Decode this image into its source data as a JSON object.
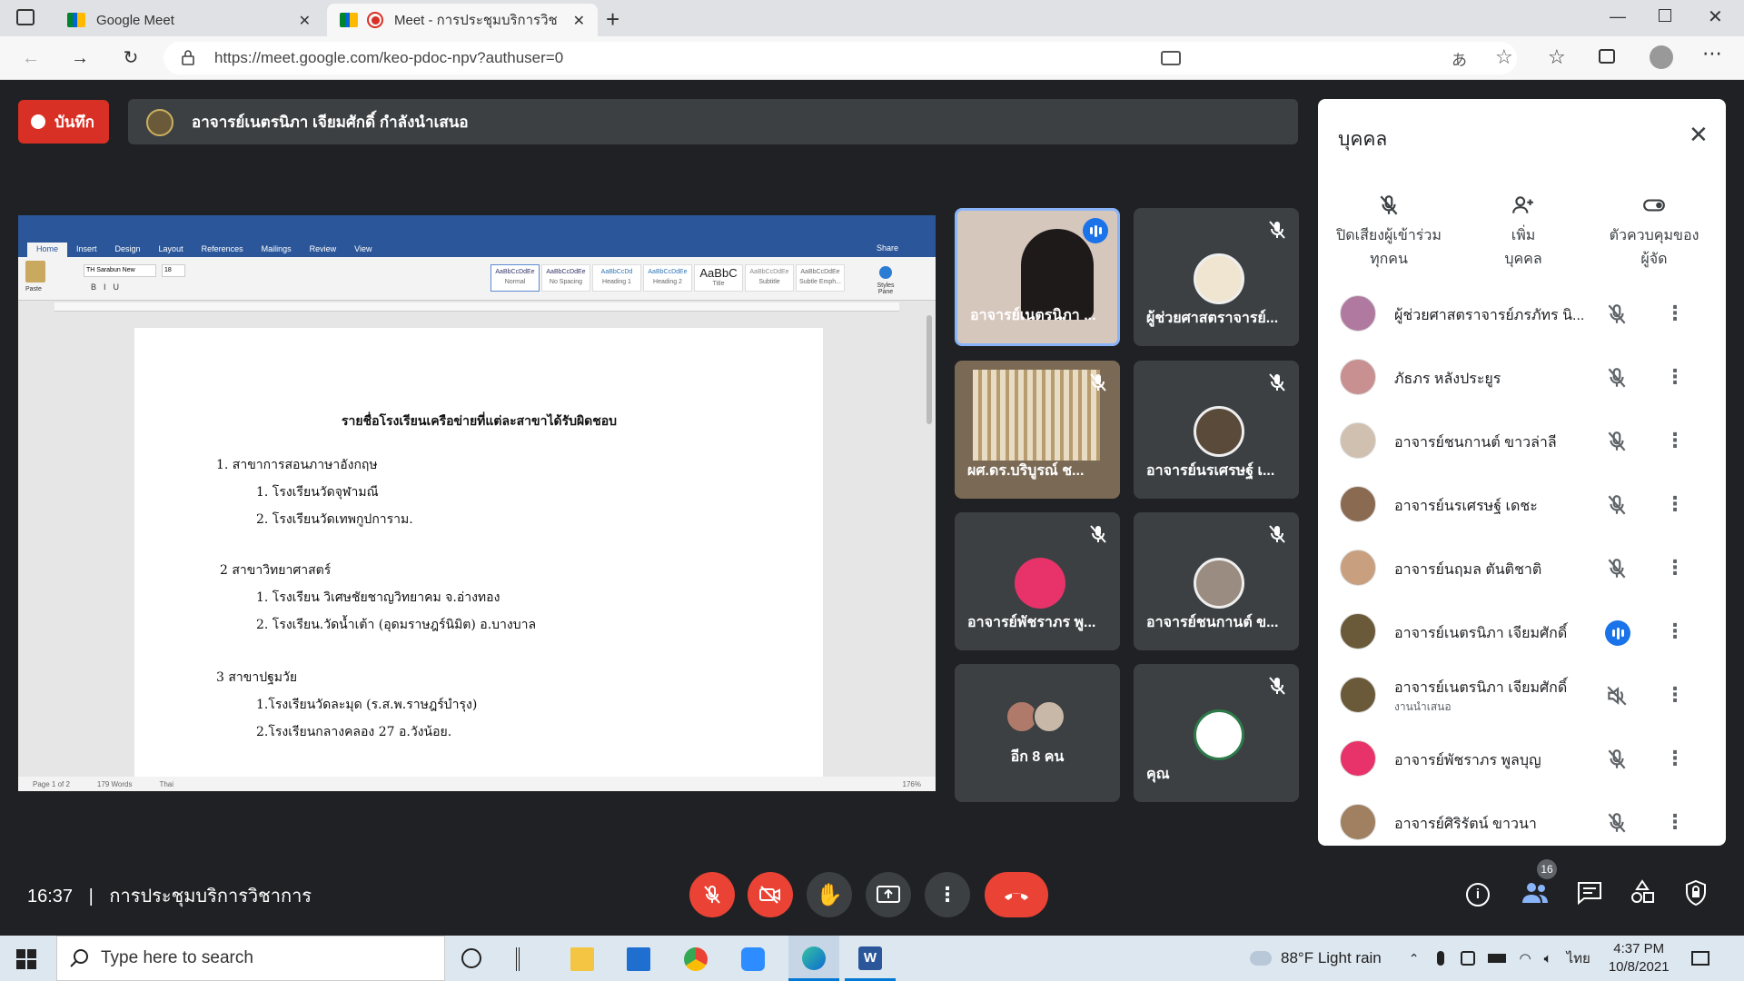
{
  "browser": {
    "tabs": [
      {
        "title": "Google Meet",
        "icon": "meet-icon"
      },
      {
        "title": "Meet - การประชุมบริการวิชาการ",
        "icon": "meet-icon",
        "recording": true
      }
    ],
    "url": "https://meet.google.com/keo-pdoc-npv?authuser=0",
    "window_controls": [
      "minimize",
      "maximize",
      "close"
    ]
  },
  "meet": {
    "record_label": "บันทึก",
    "presenting_text": "อาจารย์เนตรนิภา เจียมศักดิ์ กำลังนำเสนอ",
    "meeting_time": "16:37",
    "meeting_separator": "|",
    "meeting_name": "การประชุมบริการวิชาการ",
    "participant_count": "16"
  },
  "document": {
    "ribbon_tabs": [
      "Home",
      "Insert",
      "Design",
      "Layout",
      "References",
      "Mailings",
      "Review",
      "View"
    ],
    "share_label": "Share",
    "font_name": "TH Sarabun New",
    "font_size": "18",
    "styles": [
      "AaBbCcDdEe",
      "AaBbCcDdEe",
      "AaBbCcDd",
      "AaBbCcDdEe",
      "AaBbC",
      "AaBbCcDdEe",
      "AaBbCcDdEe"
    ],
    "style_names": [
      "Normal",
      "No Spacing",
      "Heading 1",
      "Heading 2",
      "Title",
      "Subtitle",
      "Subtle Emph..."
    ],
    "paste_label": "Paste",
    "styles_pane_label": "Styles Pane",
    "title": "รายชื่อโรงเรียนเครือข่ายที่แต่ละสาขาได้รับผิดชอบ",
    "lines": [
      "1. สาขาการสอนภาษาอังกฤษ",
      "1. โรงเรียนวัดจุฬามณี",
      "2. โรงเรียนวัดเทพกูปการาม.",
      "2 สาขาวิทยาศาสตร์",
      "1. โรงเรียน วิเศษชัยชาญวิทยาคม จ.อ่างทอง",
      "2. โรงเรียน.วัดน้ำเต้า (อุดมราษฎร์นิมิต) อ.บางบาล",
      "3 สาขาปฐมวัย",
      "1.โรงเรียนวัดละมุด (ร.ส.พ.ราษฎร์บำรุง)",
      "2.โรงเรียนกลางคลอง 27 อ.วังน้อย."
    ],
    "status": [
      "Page 1 of 2",
      "179 Words",
      "Thai"
    ],
    "zoom": "176%"
  },
  "tiles": [
    {
      "name": "อาจารย์เนตรนิภา ...",
      "state": "speaking"
    },
    {
      "name": "ผู้ช่วยศาสตราจารย์...",
      "state": "muted"
    },
    {
      "name": "ผศ.ดร.บริบูรณ์ ช...",
      "state": "muted"
    },
    {
      "name": "อาจารย์นรเศรษฐ์ เ...",
      "state": "muted"
    },
    {
      "name": "อาจารย์พัชราภร พู...",
      "state": "muted"
    },
    {
      "name": "อาจารย์ชนกานต์ ข...",
      "state": "muted"
    },
    {
      "name": "อีก 8 คน",
      "state": "more"
    },
    {
      "name": "คุณ",
      "state": "muted"
    }
  ],
  "people": {
    "title": "บุคคล",
    "actions": [
      {
        "label": "ปิดเสียงผู้เข้าร่วมทุกคน",
        "line1": "ปิดเสียงผู้เข้าร่วม",
        "line2": "ทุกคน",
        "icon": "mic-off-icon"
      },
      {
        "label": "เพิ่มบุคคล",
        "line1": "เพิ่ม",
        "line2": "บุคคล",
        "icon": "add-person-icon"
      },
      {
        "label": "ตัวควบคุมของผู้จัด",
        "line1": "ตัวควบคุมของ",
        "line2": "ผู้จัด",
        "icon": "toggle-icon"
      }
    ],
    "list": [
      {
        "name": "ผู้ช่วยศาสตราจารย์ภรภัทร นิ...",
        "sub": "",
        "state": "muted"
      },
      {
        "name": "ภัธภร หลังประยูร",
        "sub": "",
        "state": "muted"
      },
      {
        "name": "อาจารย์ชนกานต์ ขาวล่าลี",
        "sub": "",
        "state": "muted"
      },
      {
        "name": "อาจารย์นรเศรษฐ์ เดชะ",
        "sub": "",
        "state": "muted"
      },
      {
        "name": "อาจารย์นฤมล ตันติชาติ",
        "sub": "",
        "state": "muted"
      },
      {
        "name": "อาจารย์เนตรนิภา เจียมศักดิ์",
        "sub": "",
        "state": "speaking"
      },
      {
        "name": "อาจารย์เนตรนิภา เจียมศักดิ์",
        "sub": "งานนำเสนอ",
        "state": "audio-off"
      },
      {
        "name": "อาจารย์พัชราภร พูลบุญ",
        "sub": "",
        "state": "muted"
      },
      {
        "name": "อาจารย์ศิริรัตน์ ขาวนา",
        "sub": "",
        "state": "muted"
      }
    ]
  },
  "taskbar": {
    "search_placeholder": "Type here to search",
    "weather": "88°F  Light rain",
    "lang": "ไทย",
    "time": "4:37 PM",
    "date": "10/8/2021"
  },
  "colors": {
    "red": "#ea4335",
    "blue": "#1a73e8",
    "dark": "#202124",
    "tile": "#3c4043"
  }
}
